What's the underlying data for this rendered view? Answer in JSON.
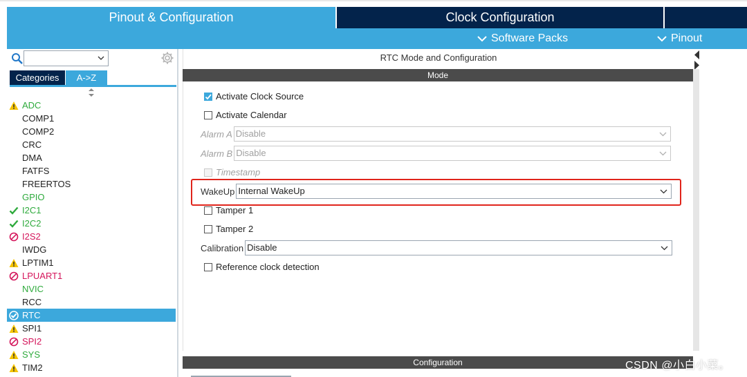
{
  "top_tabs": {
    "pinout": "Pinout & Configuration",
    "clock": "Clock Configuration"
  },
  "subbar": {
    "software_packs": "Software Packs",
    "pinout": "Pinout"
  },
  "left": {
    "search_value": "",
    "btn_categories": "Categories",
    "btn_az": "A->Z",
    "peripherals": [
      {
        "label": "ADC",
        "status": "warning",
        "color": "#2eaa3c"
      },
      {
        "label": "COMP1",
        "status": "none",
        "color": "#222222"
      },
      {
        "label": "COMP2",
        "status": "none",
        "color": "#222222"
      },
      {
        "label": "CRC",
        "status": "none",
        "color": "#222222"
      },
      {
        "label": "DMA",
        "status": "none",
        "color": "#222222"
      },
      {
        "label": "FATFS",
        "status": "none",
        "color": "#222222"
      },
      {
        "label": "FREERTOS",
        "status": "none",
        "color": "#222222"
      },
      {
        "label": "GPIO",
        "status": "none",
        "color": "#2eaa3c"
      },
      {
        "label": "I2C1",
        "status": "ok",
        "color": "#2eaa3c"
      },
      {
        "label": "I2C2",
        "status": "ok",
        "color": "#2eaa3c"
      },
      {
        "label": "I2S2",
        "status": "blocked",
        "color": "#d4145a"
      },
      {
        "label": "IWDG",
        "status": "none",
        "color": "#222222"
      },
      {
        "label": "LPTIM1",
        "status": "warning",
        "color": "#222222"
      },
      {
        "label": "LPUART1",
        "status": "blocked",
        "color": "#d4145a"
      },
      {
        "label": "NVIC",
        "status": "none",
        "color": "#2eaa3c"
      },
      {
        "label": "RCC",
        "status": "none",
        "color": "#222222"
      },
      {
        "label": "RTC",
        "status": "ok-selected",
        "color": "#ffffff"
      },
      {
        "label": "SPI1",
        "status": "warning",
        "color": "#222222"
      },
      {
        "label": "SPI2",
        "status": "blocked",
        "color": "#d4145a"
      },
      {
        "label": "SYS",
        "status": "warning",
        "color": "#2eaa3c"
      },
      {
        "label": "TIM2",
        "status": "warning",
        "color": "#222222"
      }
    ]
  },
  "right": {
    "title": "RTC Mode and Configuration",
    "mode_header": "Mode",
    "activate_clock_source": "Activate Clock Source",
    "activate_calendar": "Activate Calendar",
    "alarm_a_label": "Alarm A",
    "alarm_a_value": "Disable",
    "alarm_b_label": "Alarm B",
    "alarm_b_value": "Disable",
    "timestamp": "Timestamp",
    "wakeup_label": "WakeUp",
    "wakeup_value": "Internal WakeUp",
    "tamper1": "Tamper 1",
    "tamper2": "Tamper 2",
    "calibration_label": "Calibration",
    "calibration_value": "Disable",
    "reference_clock": "Reference clock detection",
    "config_header": "Configuration"
  },
  "watermark": "CSDN @小白小菜。",
  "colors": {
    "accent_blue": "#3ca8dc",
    "dark_navy": "#03234b",
    "highlight_red": "#e0241b"
  }
}
